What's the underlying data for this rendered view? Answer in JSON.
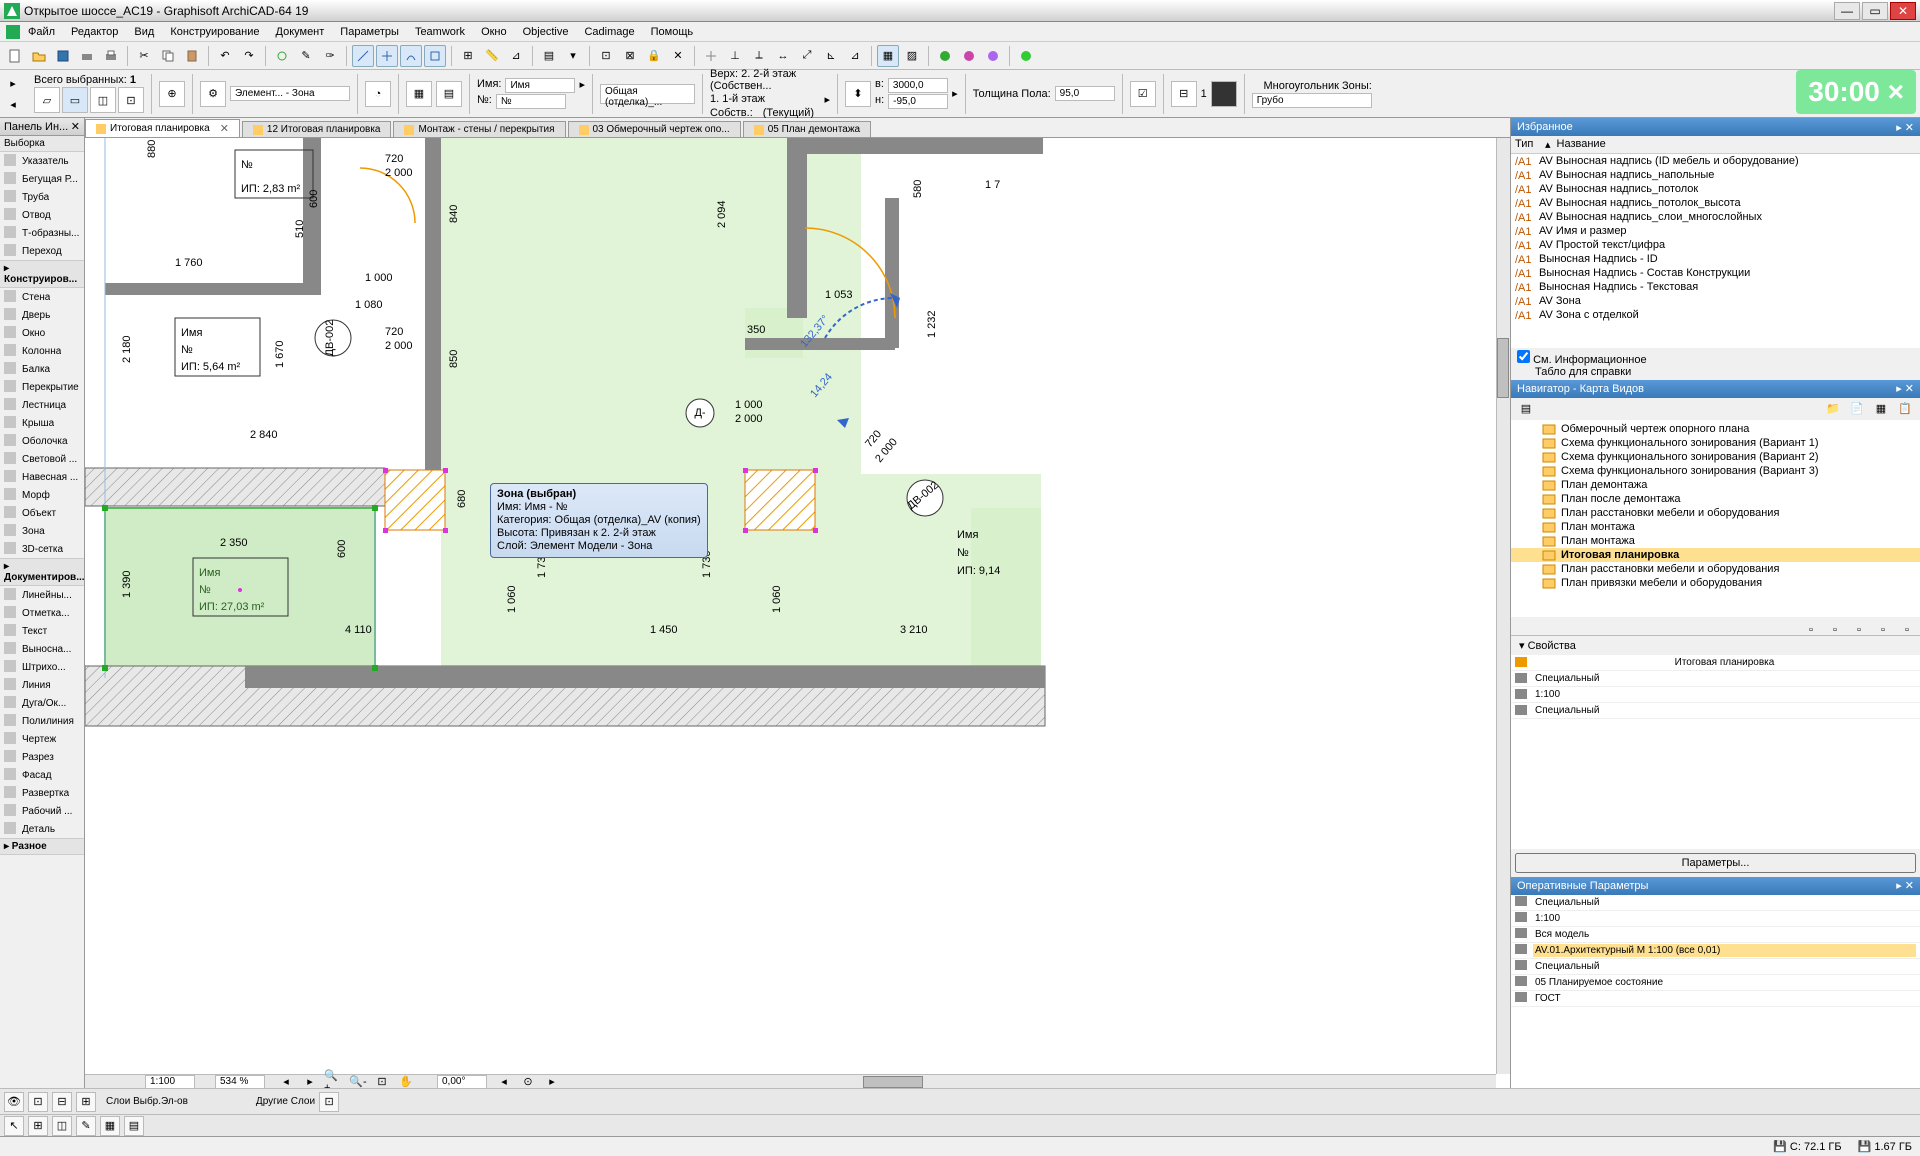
{
  "title": "Открытое шоссе_AC19 - Graphisoft ArchiCAD-64 19",
  "menu": [
    "Файл",
    "Редактор",
    "Вид",
    "Конструирование",
    "Документ",
    "Параметры",
    "Teamwork",
    "Окно",
    "Objective",
    "Cadimage",
    "Помощь"
  ],
  "timer": "30:00 ×",
  "toolbox": {
    "title": "Панель Ин...",
    "sub": "Выборка",
    "groups": [
      {
        "hdr": "",
        "items": [
          {
            "n": "Указатель"
          },
          {
            "n": "Бегущая Р..."
          }
        ]
      },
      {
        "hdr": "",
        "items": [
          {
            "n": "Труба"
          },
          {
            "n": "Отвод"
          },
          {
            "n": "Т-образны..."
          },
          {
            "n": "Переход"
          }
        ]
      },
      {
        "hdr": "Конструиров...",
        "items": [
          {
            "n": "Стена"
          },
          {
            "n": "Дверь"
          },
          {
            "n": "Окно"
          },
          {
            "n": "Колонна"
          },
          {
            "n": "Балка"
          },
          {
            "n": "Перекрытие"
          },
          {
            "n": "Лестница"
          },
          {
            "n": "Крыша"
          },
          {
            "n": "Оболочка"
          },
          {
            "n": "Световой ..."
          },
          {
            "n": "Навесная ..."
          },
          {
            "n": "Морф"
          },
          {
            "n": "Объект"
          },
          {
            "n": "Зона"
          },
          {
            "n": "3D-сетка"
          }
        ]
      },
      {
        "hdr": "Документиров...",
        "items": [
          {
            "n": "Линейны..."
          },
          {
            "n": "Отметка..."
          },
          {
            "n": "Текст"
          },
          {
            "n": "Выносна..."
          },
          {
            "n": "Штрихо..."
          },
          {
            "n": "Линия"
          },
          {
            "n": "Дуга/Ок..."
          },
          {
            "n": "Полилиния"
          },
          {
            "n": "Чертеж"
          },
          {
            "n": "Разрез"
          },
          {
            "n": "Фасад"
          },
          {
            "n": "Развертка"
          },
          {
            "n": "Рабочий ..."
          },
          {
            "n": "Деталь"
          }
        ]
      },
      {
        "hdr": "Разное",
        "items": []
      }
    ]
  },
  "info": {
    "selcount_lbl": "Всего выбранных:",
    "selcount": "1",
    "name_lbl": "Имя:",
    "name_val": "Имя",
    "no_lbl": "№:",
    "no_val": "№",
    "cat": "Общая (отделка)_...",
    "story1": "Верх: 2. 2-й этаж (Собствен...",
    "story2": "1. 1-й этаж",
    "story3": "(Текущий)",
    "story4": "Собств.:",
    "w_lbl": "в:",
    "w": "3000,0",
    "h_lbl": "н:",
    "h": "-95,0",
    "thick_lbl": "Толщина Пола:",
    "thick": "95,0",
    "layer_lbl": "Многоугольник Зоны:",
    "layer": "Грубо",
    "elem": "Элемент... - Зона"
  },
  "tabs": [
    {
      "l": "Итоговая планировка",
      "a": true,
      "x": true
    },
    {
      "l": "12 Итоговая планировка"
    },
    {
      "l": "Монтаж - стены / перекрытия"
    },
    {
      "l": "03 Обмерочный чертеж опо..."
    },
    {
      "l": "05 План демонтажа"
    }
  ],
  "canvas": {
    "dims": {
      "d1": "880",
      "d2": "1 760",
      "d3": "2 180",
      "d4": "2 840",
      "d5": "1 670",
      "d6": "510",
      "d7": "1 080",
      "d8": "600",
      "d9": "850",
      "d10": "840",
      "d11": "1 000",
      "d12": "720",
      "d13": "2 000",
      "d14": "2 094",
      "d15": "1 053",
      "d16": "580",
      "d17": "1 232",
      "d18": "132,37°",
      "d19": "14,24",
      "d20": "720",
      "d21": "2 000",
      "d22": "350",
      "d23": "1 000",
      "d24": "2 000",
      "d25": "1 390",
      "d26": "2 350",
      "d27": "600",
      "d28": "680",
      "d29": "4 110",
      "d30": "1 060",
      "d31": "1 730",
      "d32": "1 450",
      "d33": "1 060",
      "d34": "1 730",
      "d35": "3 210",
      "d36": "1 7"
    },
    "zones": [
      {
        "n": "Имя",
        "no": "№",
        "a": "ИП: 2,83 m²"
      },
      {
        "n": "Имя",
        "no": "№",
        "a": "ИП: 5,64 m²"
      },
      {
        "n": "Имя",
        "no": "№",
        "a": "ИП: 27,03 m²"
      },
      {
        "n": "Имя",
        "no": "№",
        "a": "ИП: 9,14"
      }
    ],
    "marks": [
      "ДВ-002",
      "ДВ-002",
      "Д-"
    ],
    "tooltip": {
      "t": "Зона (выбран)",
      "l1": "Имя: Имя - №",
      "l2": "Категория: Общая (отделка)_AV (копия)",
      "l3": "Высота: Привязан к 2. 2-й этаж",
      "l4": "Слой: Элемент Модели - Зона"
    }
  },
  "bottom": {
    "scale": "1:100",
    "zoom": "534 %",
    "angle": "0,00°"
  },
  "quick": {
    "l1": "Слои Выбр.Эл-ов",
    "l2": "Другие Слои"
  },
  "fav": {
    "title": "Избранное",
    "cols": [
      "Тип",
      "Название"
    ],
    "items": [
      "AV Выносная надпись (ID мебель и оборудование)",
      "AV Выносная надпись_напольные",
      "AV Выносная надпись_потолок",
      "AV Выносная надпись_потолок_высота",
      "AV Выносная надпись_слои_многослойных",
      "AV Имя и размер",
      "AV Простой текст/цифра",
      "Выносная Надпись - ID",
      "Выносная Надпись - Состав Конструкции",
      "Выносная Надпись - Текстовая",
      "AV Зона",
      "AV Зона с отделкой"
    ],
    "chk": "См. Информационное",
    "note": "Табло для справки"
  },
  "nav": {
    "title": "Навигатор - Карта Видов",
    "items": [
      "Обмерочный чертеж опорного плана",
      "Схема функционального зонирования (Вариант 1)",
      "Схема функционального зонирования (Вариант 2)",
      "Схема функционального зонирования (Вариант 3)",
      "План демонтажа",
      "План после демонтажа",
      "План расстановки мебели и оборудования",
      "План монтажа",
      "План монтажа",
      "Итоговая планировка",
      "План расстановки мебели и оборудования",
      "План привязки мебели и оборудования"
    ],
    "sel": 9
  },
  "props": {
    "hdr": "Свойства",
    "doc": "Итоговая планировка",
    "rows": [
      "Специальный",
      "1:100",
      "Специальный"
    ],
    "btn": "Параметры..."
  },
  "oper": {
    "title": "Оперативные Параметры",
    "rows": [
      "Специальный",
      "1:100",
      "Вся модель",
      "AV.01.Архитектурный М 1:100 (все 0,01)",
      "Специальный",
      "05 Планируемое состояние",
      "ГОСТ"
    ]
  },
  "status": {
    "c": "C: 72.1 ГБ",
    "d": "1.67 ГБ"
  }
}
